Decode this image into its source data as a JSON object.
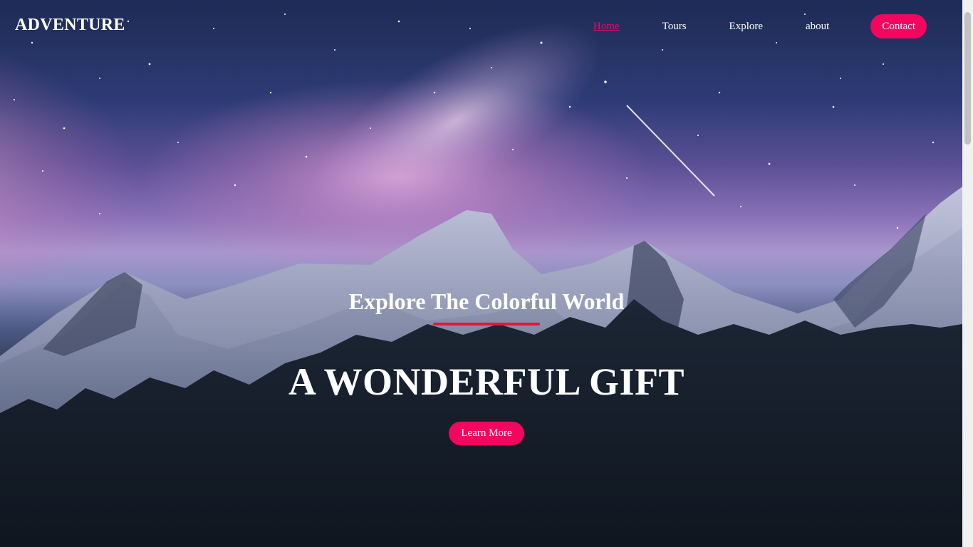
{
  "brand": {
    "logo_text": "ADVENTURE"
  },
  "nav": {
    "links": [
      {
        "label": "Home",
        "active": true
      },
      {
        "label": "Tours",
        "active": false
      },
      {
        "label": "Explore",
        "active": false
      },
      {
        "label": "about",
        "active": false
      }
    ],
    "contact_label": "Contact"
  },
  "hero": {
    "subtitle": "Explore The Colorful World",
    "headline": "A WONDERFUL GIFT",
    "cta_label": "Learn More",
    "background_scene": "starry-sky-mountains-forest"
  },
  "colors": {
    "accent": "#f3075e",
    "underline": "#e8143d",
    "text": "#ffffff"
  }
}
